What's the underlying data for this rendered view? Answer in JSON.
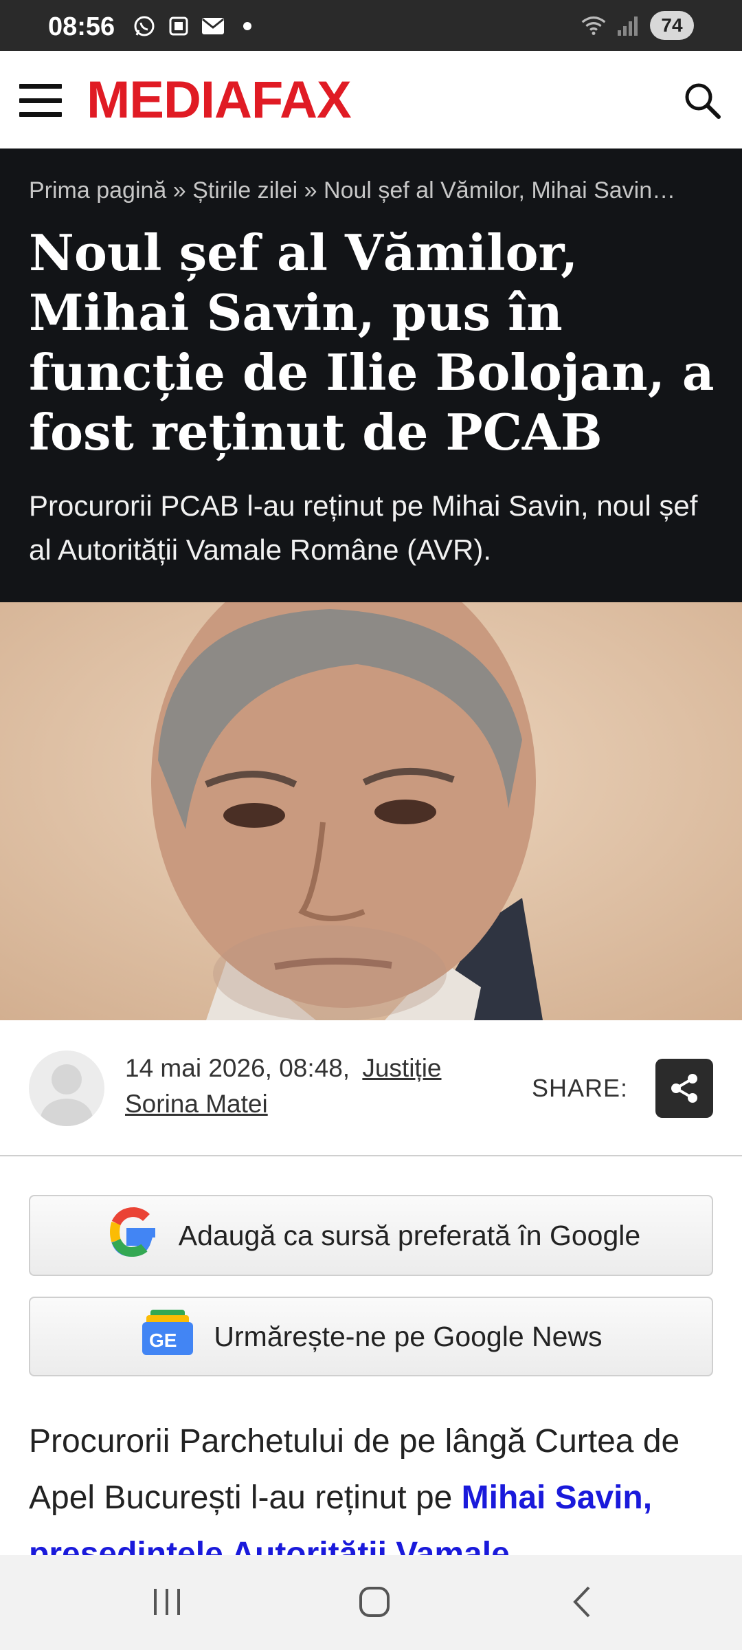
{
  "status_bar": {
    "time": "08:56",
    "battery": "74",
    "icons": [
      "whatsapp-icon",
      "screenshot-icon",
      "mail-icon",
      "dot-icon",
      "wifi-icon",
      "signal-icon",
      "battery-icon"
    ]
  },
  "header": {
    "logo": "MEDIAFAX",
    "brand_color": "#e01b24",
    "menu_icon": "hamburger-menu-icon",
    "search_icon": "search-icon"
  },
  "article": {
    "breadcrumb": {
      "home": "Prima pagină",
      "sep": "»",
      "section": "Știrile zilei",
      "current": "Noul șef al Vămilor, Mihai Savin…"
    },
    "headline": "Noul șef al Vămilor, Mihai Savin, pus în funcție de Ilie Bolojan, a fost reținut de PCAB",
    "lede": "Procurorii PCAB l-au reținut pe Mihai Savin, noul șef al Autorității Vamale Române (AVR).",
    "date": "14 mai 2026, 08:48,",
    "category": "Justiție",
    "author": "Sorina Matei",
    "share_label": "SHARE:",
    "body_start": "Procurorii Parchetului de pe lângă Curtea de Apel București l-au reținut pe ",
    "body_link": "Mihai Savin, președintele Autorității Vamale"
  },
  "google_buttons": {
    "preferred": "Adaugă ca sursă preferată în Google",
    "news": "Urmărește-ne pe Google News"
  }
}
